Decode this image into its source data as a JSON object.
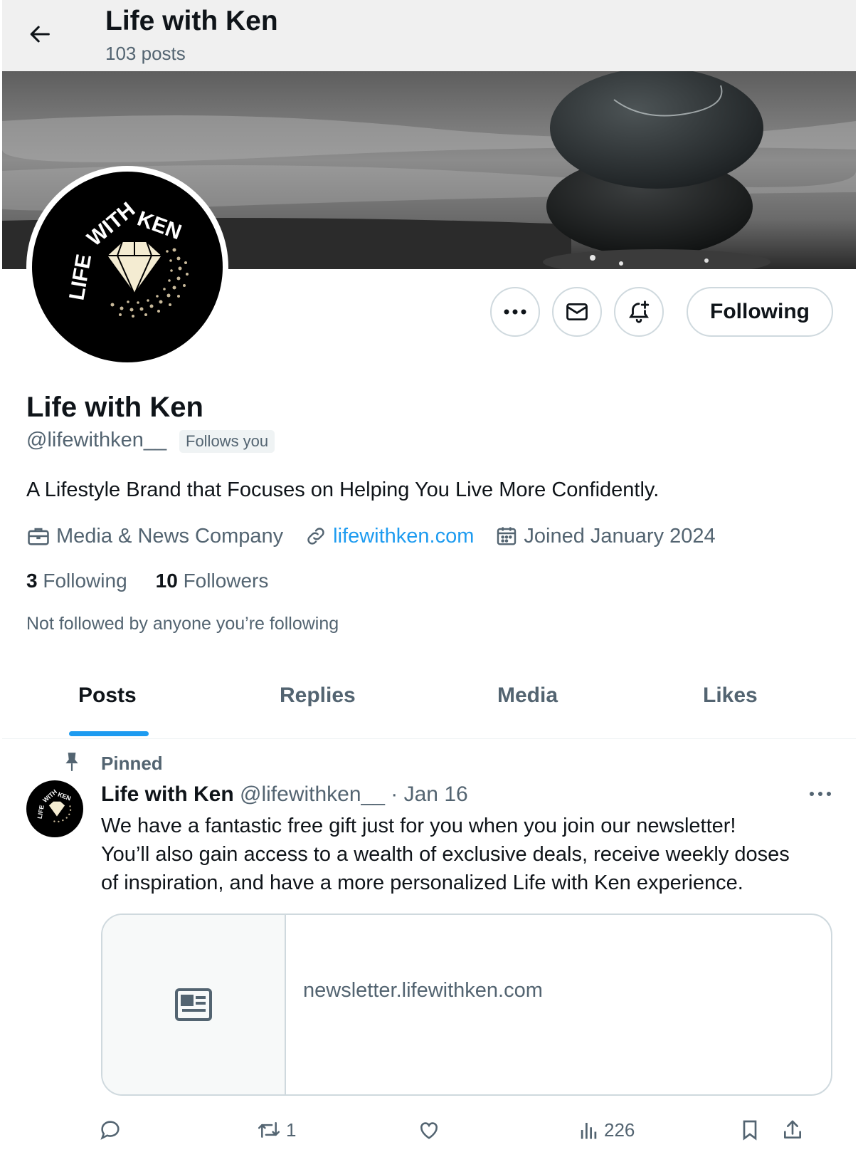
{
  "header": {
    "title": "Life with Ken",
    "post_count": "103 posts"
  },
  "profile": {
    "name": "Life with Ken",
    "handle": "@lifewithken__",
    "follows_you": "Follows you",
    "bio": "A Lifestyle Brand that Focuses on Helping You Live More Confidently.",
    "category": "Media & News Company",
    "website": "lifewithken.com",
    "joined": "Joined January 2024",
    "following_count": "3",
    "following_label": "Following",
    "followers_count": "10",
    "followers_label": "Followers",
    "not_followed_text": "Not followed by anyone you’re following",
    "logo_text": "LIFE WITH KEN"
  },
  "actions": {
    "following_label": "Following"
  },
  "tabs": [
    {
      "label": "Posts",
      "active": true
    },
    {
      "label": "Replies"
    },
    {
      "label": "Media"
    },
    {
      "label": "Likes"
    }
  ],
  "post": {
    "pinned_label": "Pinned",
    "author_name": "Life with Ken",
    "author_handle": "@lifewithken__",
    "separator": "·",
    "date": "Jan 16",
    "text_lines": [
      "We have a fantastic free gift just for you when you join our newsletter!",
      "You’ll also gain access to a wealth of exclusive deals, receive weekly  doses",
      "of inspiration, and have a more personalized Life with Ken  experience."
    ],
    "card_domain": "newsletter.lifewithken.com",
    "retweets": "1",
    "views": "226"
  },
  "colors": {
    "accent": "#1d9bf0",
    "secondary_text": "#536471",
    "border": "#cfd9de"
  }
}
